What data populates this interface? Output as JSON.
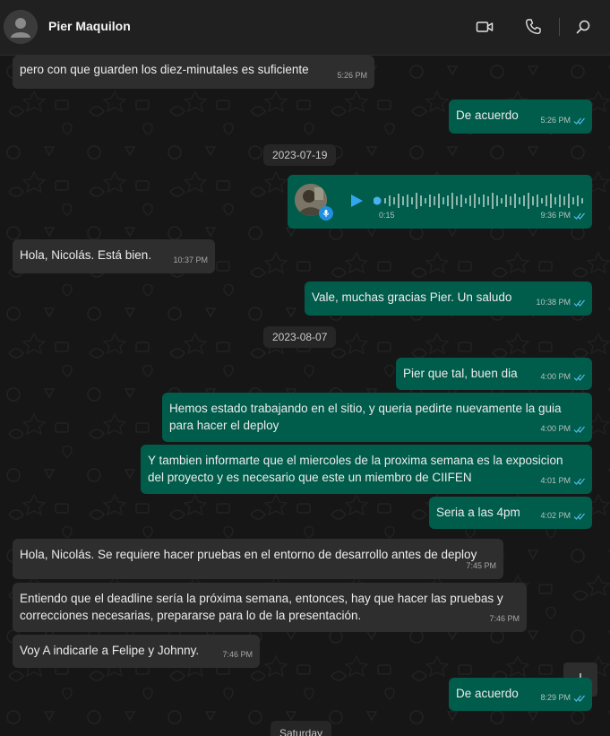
{
  "header": {
    "contact_name": "Pier Maquilon"
  },
  "messages": {
    "m1": {
      "text": "pero con que guarden los diez-minutales es suficiente",
      "time": "5:26 PM"
    },
    "m2": {
      "text": "De acuerdo",
      "time": "5:26 PM"
    },
    "d1": "2023-07-19",
    "voice": {
      "duration": "0:15",
      "time": "9:36 PM"
    },
    "m3": {
      "text": "Hola, Nicolás. Está bien.",
      "time": "10:37 PM"
    },
    "m4": {
      "text": "Vale, muchas gracias Pier. Un saludo",
      "time": "10:38 PM"
    },
    "d2": "2023-08-07",
    "m5": {
      "text": "Pier que tal, buen dia",
      "time": "4:00 PM"
    },
    "m6": {
      "line1": "Hemos estado trabajando en el sitio, y queria pedirte nuevamente la guia",
      "line2": "para hacer el deploy",
      "time": "4:00 PM"
    },
    "m7": {
      "line1": "Y tambien informarte que el miercoles de la proxima semana es la exposicion",
      "line2": "del proyecto y es necesario que este un miembro de CIIFEN",
      "time": "4:01 PM"
    },
    "m8": {
      "text": "Seria a las 4pm",
      "time": "4:02 PM"
    },
    "m9": {
      "text": "Hola, Nicolás. Se requiere hacer pruebas en el entorno de desarrollo antes de deploy",
      "time": "7:45 PM"
    },
    "m10": {
      "line1": "Entiendo que el deadline sería la próxima semana, entonces, hay que hacer las pruebas y",
      "line2": "correcciones necesarias, prepararse para lo de la presentación.",
      "time": "7:46 PM"
    },
    "m11": {
      "text": "Voy A indicarle a Felipe y Johnny.",
      "time": "7:46 PM"
    },
    "m12": {
      "text": "De acuerdo",
      "time": "8:29 PM"
    },
    "d3": "Saturday"
  },
  "colors": {
    "incoming": "#2e2e2e",
    "outgoing": "#005c4b",
    "read_tick": "#53bdeb",
    "accent": "#1f8fe0"
  },
  "icons": {
    "header": [
      "video-call-icon",
      "phone-icon",
      "search-icon"
    ],
    "voice": [
      "play-icon",
      "mic-icon"
    ],
    "status": "double-check-icon",
    "scroll": "arrow-down-icon"
  }
}
